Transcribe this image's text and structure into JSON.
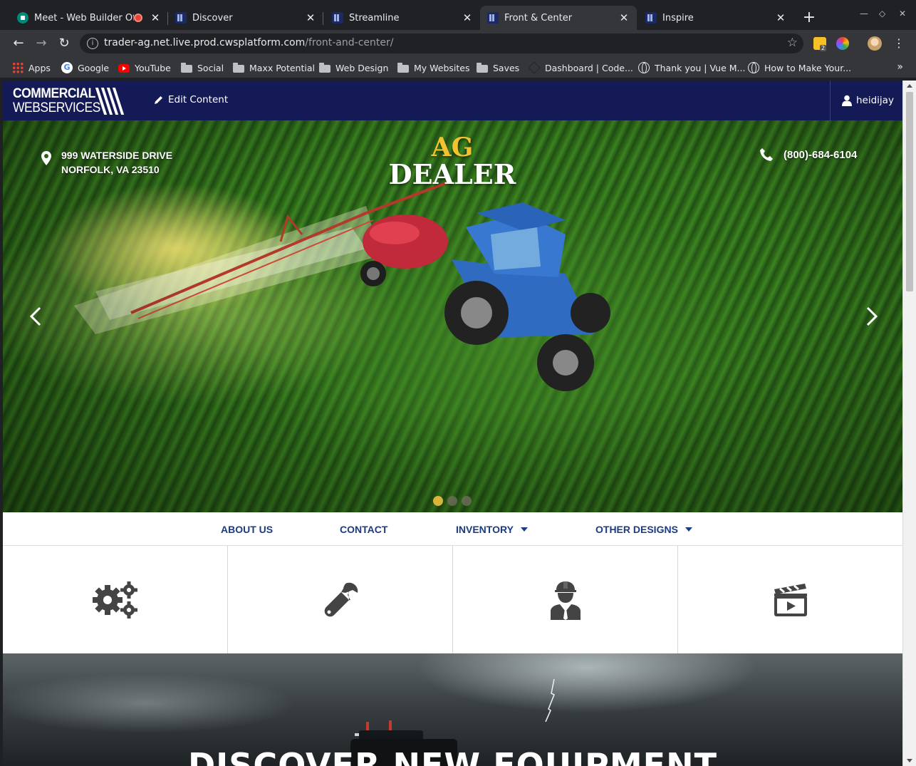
{
  "browser": {
    "tabs": [
      {
        "title": "Meet - Web Builder Offic",
        "recording": true
      },
      {
        "title": "Discover"
      },
      {
        "title": "Streamline"
      },
      {
        "title": "Front & Center",
        "active": true
      },
      {
        "title": "Inspire"
      }
    ],
    "url_host": "trader-ag.net.live.prod.cwsplatform.com",
    "url_path": "/front-and-center/",
    "extension_badge": "2",
    "bookmarks": [
      {
        "label": "Apps",
        "icon": "apps-grid-icon"
      },
      {
        "label": "Google",
        "icon": "google-icon"
      },
      {
        "label": "YouTube",
        "icon": "youtube-icon"
      },
      {
        "label": "Social",
        "icon": "folder-icon"
      },
      {
        "label": "Maxx Potential",
        "icon": "folder-icon"
      },
      {
        "label": "Web Design",
        "icon": "folder-icon"
      },
      {
        "label": "My Websites",
        "icon": "folder-icon"
      },
      {
        "label": "Saves",
        "icon": "folder-icon"
      },
      {
        "label": "Dashboard | Code...",
        "icon": "codepen-icon"
      },
      {
        "label": "Thank you | Vue M...",
        "icon": "globe-icon"
      },
      {
        "label": "How to Make Your...",
        "icon": "globe-icon"
      }
    ],
    "bookmarks_overflow": "»"
  },
  "site": {
    "logo_line1": "COMMERCIAL",
    "logo_line2": "WEBSERVICES",
    "edit_label": "Edit Content",
    "username": "heidijay",
    "colors": {
      "header_bg": "#141a55",
      "nav_text": "#1b3b83",
      "accent_gold": "#f2c230"
    }
  },
  "hero": {
    "address_line1": "999 WATERSIDE DRIVE",
    "address_line2": "NORFOLK, VA 23510",
    "title_line1": "AG",
    "title_line2": "DEALER",
    "phone": "(800)-684-6104",
    "slides": 3,
    "active_slide": 1
  },
  "nav": [
    {
      "label": "ABOUT US",
      "dropdown": false
    },
    {
      "label": "CONTACT",
      "dropdown": false
    },
    {
      "label": "INVENTORY",
      "dropdown": true
    },
    {
      "label": "OTHER DESIGNS",
      "dropdown": true
    }
  ],
  "tiles": [
    {
      "icon": "gears-icon"
    },
    {
      "icon": "wrench-icon"
    },
    {
      "icon": "technician-icon"
    },
    {
      "icon": "video-clapper-icon"
    }
  ],
  "banner": {
    "title": "DISCOVER NEW EQUIPMENT"
  }
}
